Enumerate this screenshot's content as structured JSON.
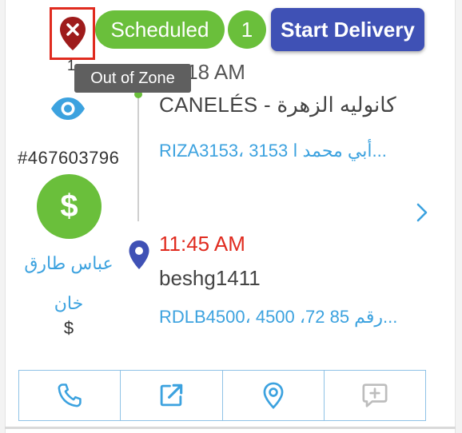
{
  "header": {
    "status_label": "Scheduled",
    "count_label": "1",
    "start_delivery_label": "Start Delivery",
    "out_of_zone_tooltip": "Out of Zone",
    "mark_text": "1"
  },
  "left": {
    "order_number": "#467603796",
    "payment_symbol": "$",
    "customer_name": "عباس طارق خان",
    "customer_amount": "$"
  },
  "stops": [
    {
      "time": "11:18 AM",
      "name": "CANELÉS - كانوليه الزهرة",
      "address": "RIZA3153، 3153 أبي محمد ا..."
    },
    {
      "time": "11:45 AM",
      "name": "beshg1411",
      "address": "RDLB4500، 4500 ،72 رقم 85..."
    }
  ],
  "colors": {
    "green": "#6abf3b",
    "indigo": "#3f51b5",
    "link_blue": "#3ca2df",
    "red": "#e02b1f",
    "maroon": "#9e1b1b"
  },
  "icons": {
    "out_of_zone": "map-pin-x-icon",
    "eye": "eye-icon",
    "dollar": "dollar-icon",
    "location": "map-pin-icon",
    "chevron": "chevron-right-icon",
    "phone": "phone-icon",
    "open": "external-link-icon",
    "map": "location-marker-icon",
    "message": "message-plus-icon"
  }
}
